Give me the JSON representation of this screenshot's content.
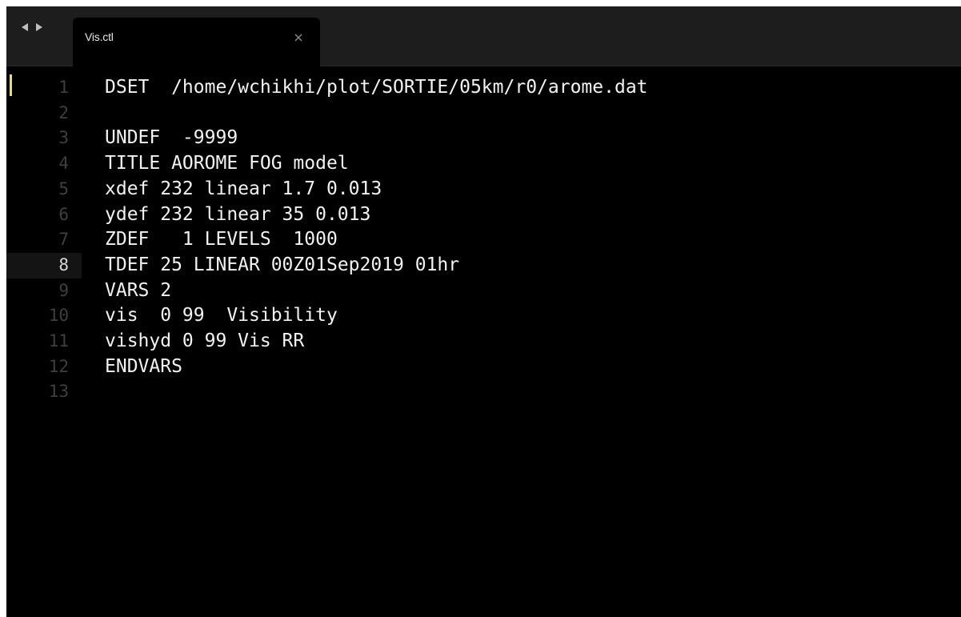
{
  "tabbar": {
    "back_icon": "triangle-left-icon",
    "forward_icon": "triangle-right-icon",
    "tab": {
      "label": "Vis.ctl",
      "close_glyph": "×",
      "close_icon": "close-icon"
    }
  },
  "editor": {
    "current_line": 8,
    "lines": [
      {
        "number": "1",
        "text": "DSET  /home/wchikhi/plot/SORTIE/05km/r0/arome.dat"
      },
      {
        "number": "2",
        "text": ""
      },
      {
        "number": "3",
        "text": "UNDEF  -9999"
      },
      {
        "number": "4",
        "text": "TITLE AOROME FOG model"
      },
      {
        "number": "5",
        "text": "xdef 232 linear 1.7 0.013"
      },
      {
        "number": "6",
        "text": "ydef 232 linear 35 0.013"
      },
      {
        "number": "7",
        "text": "ZDEF   1 LEVELS  1000"
      },
      {
        "number": "8",
        "text": "TDEF 25 LINEAR 00Z01Sep2019 01hr"
      },
      {
        "number": "9",
        "text": "VARS 2"
      },
      {
        "number": "10",
        "text": "vis  0 99  Visibility"
      },
      {
        "number": "11",
        "text": "vishyd 0 99 Vis RR"
      },
      {
        "number": "12",
        "text": "ENDVARS"
      },
      {
        "number": "13",
        "text": ""
      }
    ]
  },
  "colors": {
    "background": "#000000",
    "tabbar": "#1d1d1d",
    "text": "#f2f2f2",
    "line_number": "#3f3f3f",
    "current_line_number": "#d8d8d8",
    "caret_marker": "#e6db74"
  }
}
